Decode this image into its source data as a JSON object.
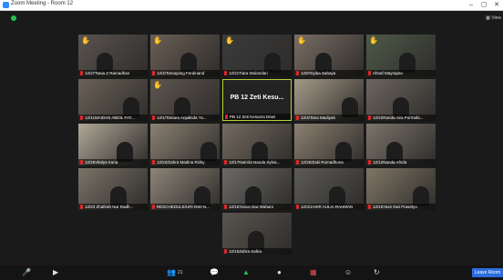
{
  "window": {
    "title": "Zoom Meeting - Room 12",
    "view_label": "View",
    "controls": [
      "–",
      "▢",
      "✕"
    ]
  },
  "colors": {
    "background": "#1a1a1a",
    "active_speaker_border": "#b3d334",
    "muted_mic": "#e02828",
    "raised_hand": "#f5b800",
    "leave_button": "#2d6cdf"
  },
  "active_speaker": {
    "big_name": "PB 12 Zeti Kesu...",
    "label": "PB 12 Zeti Kesuma Dewi"
  },
  "participants": [
    {
      "name": "12/27Tania Z Ramadhan",
      "hand": true
    },
    {
      "name": "12/4/Tamayang Ferdinand",
      "hand": true
    },
    {
      "name": "12/21Tiara Wulandari",
      "hand": true
    },
    {
      "name": "12/6Toyiba Sahaya",
      "hand": true
    },
    {
      "name": "Ahnaf Mayrapan",
      "hand": true
    },
    {
      "name": "12/11MAIDAN ABDIL FAT...",
      "hand": false
    },
    {
      "name": "12/1/Tamara Anjalinda Yu...",
      "hand": true
    },
    {
      "name": "PB 12 Zeti Kesuma Dewi",
      "hand": false,
      "active": true
    },
    {
      "name": "12/4/Tana Madiyah",
      "hand": false
    },
    {
      "name": "12/22Randa Aira Pormafa...",
      "hand": false
    },
    {
      "name": "12/25Vitalya Irana",
      "hand": false
    },
    {
      "name": "12/22/Zahra Madina Rizky",
      "hand": false
    },
    {
      "name": "12/17Namira Nanda Sylva...",
      "hand": false
    },
    {
      "name": "12/20/Zaki Romadhona",
      "hand": false
    },
    {
      "name": "12/12Nanda Afrida",
      "hand": false
    },
    {
      "name": "12/23 Zhafirah Nur Radh...",
      "hand": false
    },
    {
      "name": "RESCHEDULE/URI DWI N...",
      "hand": false
    },
    {
      "name": "12/16Yunos Dwi Wahani",
      "hand": false
    },
    {
      "name": "12/3/JASIR AULIA RAHMAN",
      "hand": false
    },
    {
      "name": "12/19Yasir Dwi Prasetyo",
      "hand": false
    },
    {
      "name": "12/15Zahra Safira",
      "hand": false
    }
  ],
  "toolbar": {
    "participant_count": "21",
    "leave_label": "Leave Room"
  }
}
